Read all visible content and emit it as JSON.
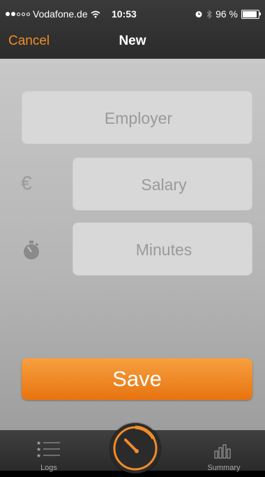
{
  "status_bar": {
    "carrier": "Vodafone.de",
    "time": "10:53",
    "battery": "96 %"
  },
  "nav": {
    "cancel_label": "Cancel",
    "title": "New"
  },
  "form": {
    "employer_placeholder": "Employer",
    "salary_placeholder": "Salary",
    "minutes_placeholder": "Minutes",
    "currency_symbol": "€",
    "save_label": "Save"
  },
  "tabbar": {
    "logs_label": "Logs",
    "summary_label": "Summary"
  },
  "colors": {
    "accent": "#f28c28",
    "background_top": "#c8c8c8",
    "bar": "#333333"
  }
}
